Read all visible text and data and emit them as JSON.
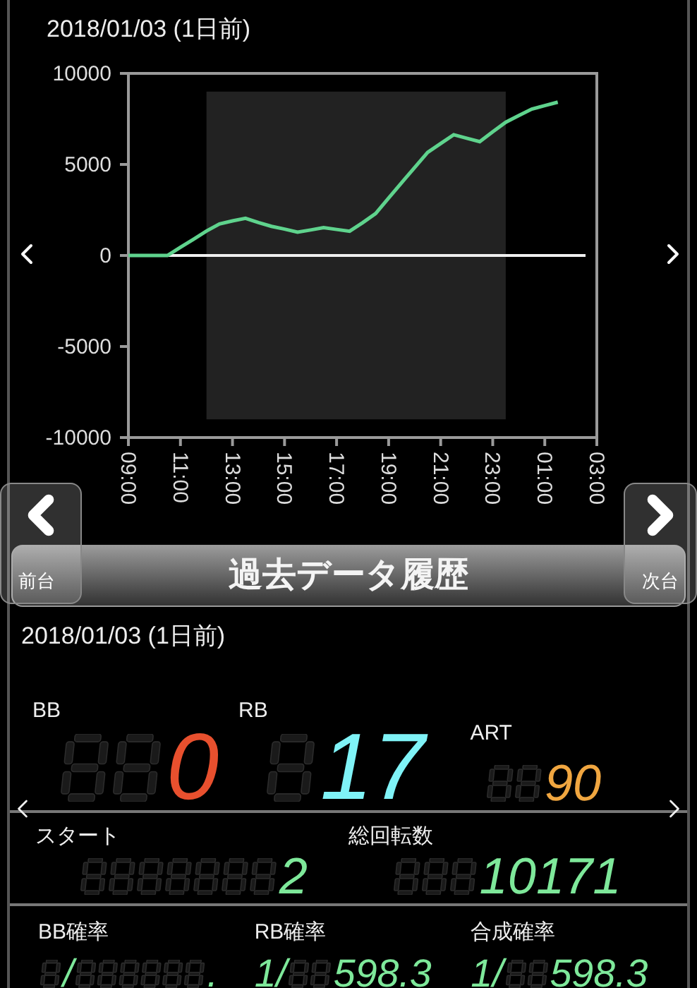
{
  "title": "2018/01/03 (1日前)",
  "chart": {
    "chart_data": {
      "type": "line",
      "categories": [
        "09:00",
        null,
        null,
        null,
        "11:00",
        null,
        null,
        null,
        "13:00",
        null,
        null,
        null,
        "15:00",
        null,
        null,
        null,
        "17:00",
        null,
        null,
        null,
        "19:00",
        null,
        null,
        null,
        "21:00",
        null,
        null,
        null,
        "23:00",
        null,
        null,
        null,
        "01:00",
        null,
        null,
        null,
        "03:00"
      ],
      "series": [
        {
          "color": "#5fd38d",
          "values": [
            0,
            0,
            0,
            0,
            450,
            890,
            1340,
            1730,
            1900,
            2040,
            1810,
            1600,
            1450,
            1280,
            1400,
            1530,
            1430,
            1330,
            1800,
            2300,
            3150,
            4000,
            4830,
            5660,
            6150,
            6630,
            6440,
            6250,
            6790,
            7320,
            7680,
            8040,
            8230,
            8420,
            null,
            null,
            null
          ]
        }
      ],
      "ylim": [
        -10000,
        10000
      ],
      "yticks": [
        -10000,
        -5000,
        0,
        5000,
        10000
      ]
    }
  },
  "nav": {
    "prev_label": "前台",
    "next_label": "次台"
  },
  "section_title": "過去データ履歴",
  "summary": {
    "date": "2018/01/03 (1日前)",
    "counters": [
      {
        "label": "BB",
        "value": "0",
        "kind": "large",
        "color": "#e8502e"
      },
      {
        "label": "RB",
        "value": "17",
        "kind": "large",
        "color": "#7ff3f7"
      },
      {
        "label": "ART",
        "value": "90",
        "kind": "small",
        "color": "#f0a640"
      }
    ],
    "totals": [
      {
        "label": "スタート",
        "value": "2"
      },
      {
        "label": "総回転数",
        "value": "10171"
      }
    ],
    "probabilities": [
      {
        "label": "BB確率",
        "prefix": "/",
        "value": "."
      },
      {
        "label": "RB確率",
        "prefix": "1/",
        "value": "598.3"
      },
      {
        "label": "合成確率",
        "prefix": "1/",
        "value": "598.3"
      }
    ]
  }
}
